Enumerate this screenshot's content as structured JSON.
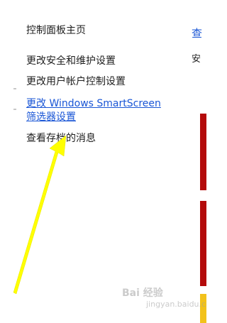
{
  "sidebar": {
    "home_link": "控制面板主页",
    "tasks": [
      {
        "label": "更改安全和维护设置"
      },
      {
        "label": "更改用户帐户控制设置"
      },
      {
        "label": "更改 Windows SmartScreen",
        "label_line2": "筛选器设置"
      },
      {
        "label": "查看存档的消息"
      }
    ]
  },
  "main": {
    "title_fragment": "查",
    "subtitle_fragment": "安"
  },
  "annotation": {
    "arrow_color": "#ffff00"
  },
  "watermark": {
    "logo": "Bai 经验",
    "sub": "jingyan.baidu.com"
  },
  "colors": {
    "link_blue": "#1a56d6",
    "status_red": "#b40b0b",
    "status_yellow": "#f2c21b"
  }
}
